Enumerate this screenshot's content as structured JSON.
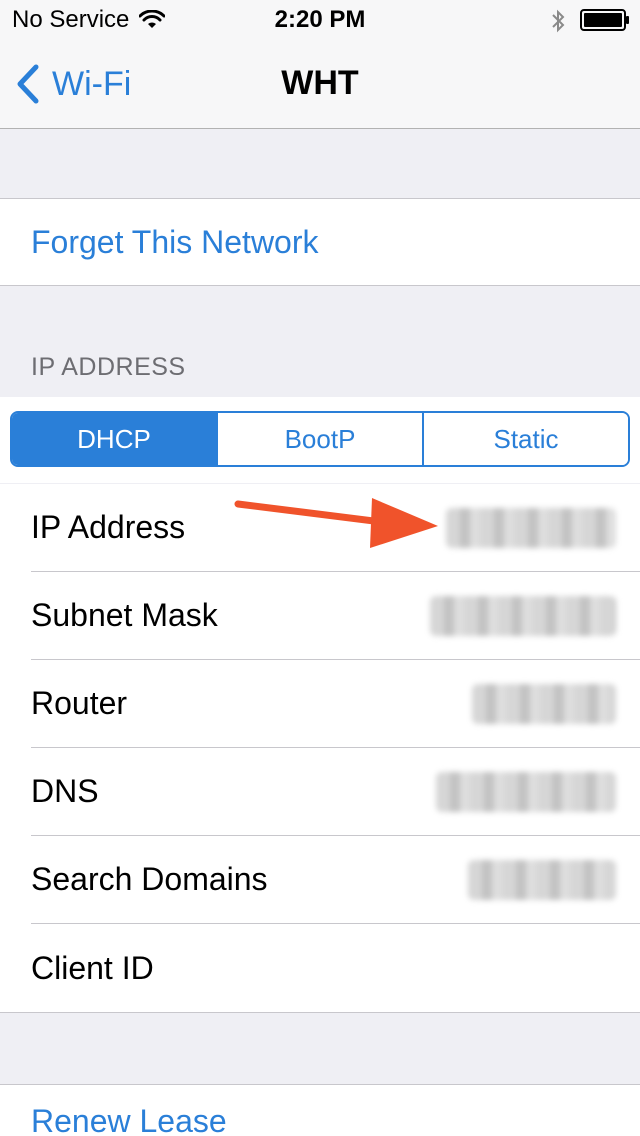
{
  "status_bar": {
    "carrier": "No Service",
    "time": "2:20 PM",
    "icons": [
      "wifi-icon",
      "bluetooth-icon",
      "battery-icon"
    ]
  },
  "nav": {
    "back_label": "Wi-Fi",
    "title": "WHT"
  },
  "actions": {
    "forget": "Forget This Network",
    "renew": "Renew Lease"
  },
  "ip_section": {
    "header": "IP ADDRESS",
    "segments": [
      {
        "label": "DHCP",
        "selected": true
      },
      {
        "label": "BootP",
        "selected": false
      },
      {
        "label": "Static",
        "selected": false
      }
    ]
  },
  "rows": [
    {
      "label": "IP Address"
    },
    {
      "label": "Subnet Mask"
    },
    {
      "label": "Router"
    },
    {
      "label": "DNS"
    },
    {
      "label": "Search Domains"
    },
    {
      "label": "Client ID"
    }
  ],
  "colors": {
    "accent": "#2a7fd8",
    "annotation_arrow": "#f0532b",
    "background": "#efeff4"
  }
}
